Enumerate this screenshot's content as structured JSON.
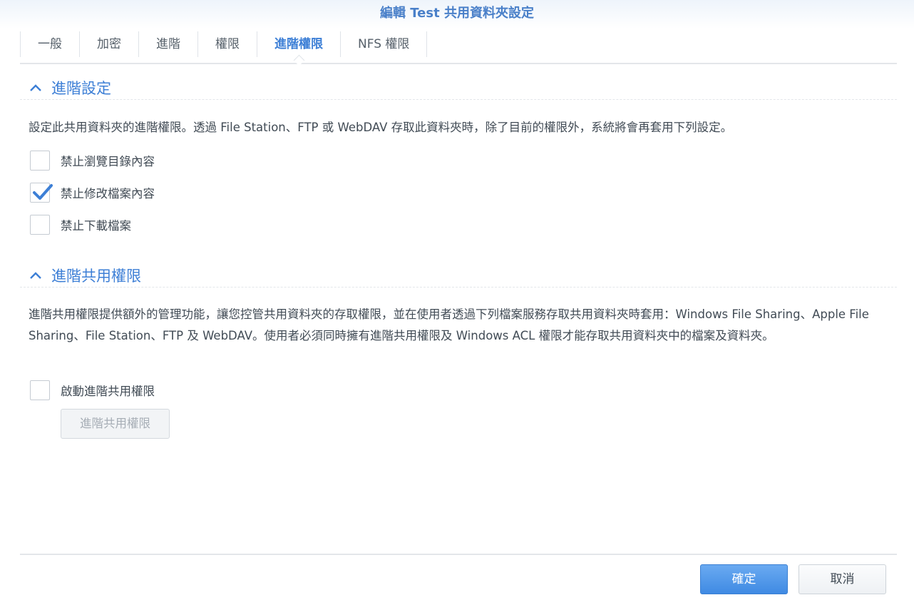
{
  "window": {
    "title": "編輯 Test 共用資料夾設定"
  },
  "tabs": [
    {
      "label": "一般",
      "active": false
    },
    {
      "label": "加密",
      "active": false
    },
    {
      "label": "進階",
      "active": false
    },
    {
      "label": "權限",
      "active": false
    },
    {
      "label": "進階權限",
      "active": true
    },
    {
      "label": "NFS 權限",
      "active": false
    }
  ],
  "advanced_settings": {
    "title": "進階設定",
    "description": "設定此共用資料夾的進階權限。透過 File Station、FTP 或 WebDAV 存取此資料夾時，除了目前的權限外，系統將會再套用下列設定。",
    "options": [
      {
        "label": "禁止瀏覽目錄內容",
        "checked": false
      },
      {
        "label": "禁止修改檔案內容",
        "checked": true
      },
      {
        "label": "禁止下載檔案",
        "checked": false
      }
    ]
  },
  "advanced_share": {
    "title": "進階共用權限",
    "description": "進階共用權限提供額外的管理功能，讓您控管共用資料夾的存取權限，並在使用者透過下列檔案服務存取共用資料夾時套用：Windows File Sharing、Apple File Sharing、File Station、FTP 及 WebDAV。使用者必須同時擁有進階共用權限及 Windows ACL 權限才能存取共用資料夾中的檔案及資料夾。",
    "enable_label": "啟動進階共用權限",
    "enable_checked": false,
    "button_label": "進階共用權限"
  },
  "footer": {
    "ok_label": "確定",
    "cancel_label": "取消"
  },
  "colors": {
    "accent": "#3d7fd6",
    "primary_button": "#4a90e2"
  }
}
